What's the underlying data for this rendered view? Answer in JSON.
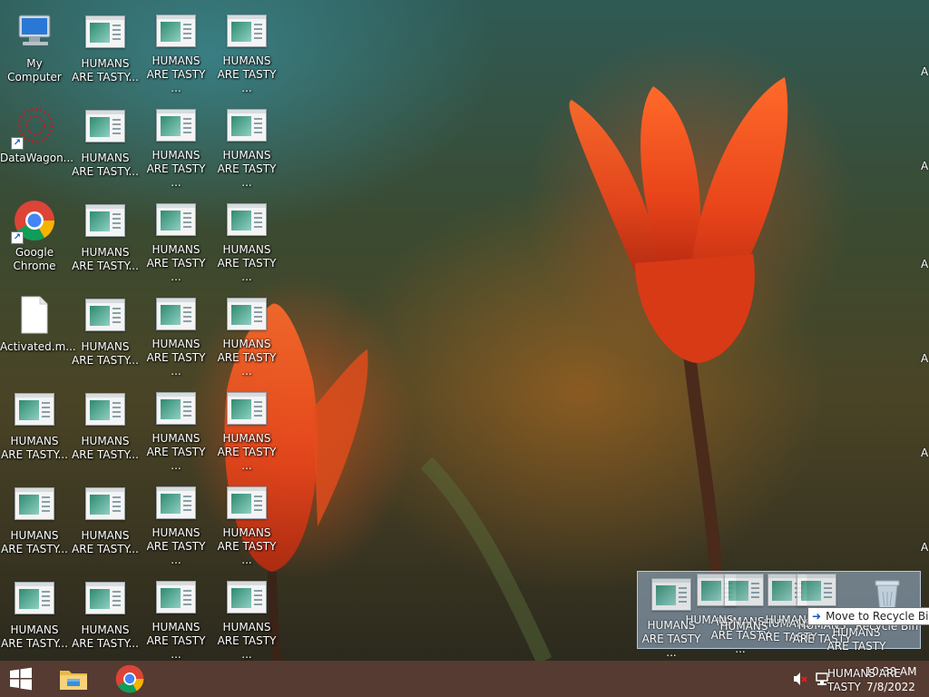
{
  "desktop": {
    "icons": [
      {
        "label": "My Computer",
        "type": "computer"
      },
      {
        "label": "DataWagon...",
        "type": "datawagon"
      },
      {
        "label": "Google Chrome",
        "type": "chrome"
      },
      {
        "label": "Activated.m...",
        "type": "file"
      },
      {
        "label": "HUMANS ARE TASTY...",
        "type": "app"
      },
      {
        "label": "HUMANS ARE TASTY...",
        "type": "app"
      },
      {
        "label": "HUMANS ARE TASTY...",
        "type": "app"
      }
    ],
    "grid_labels": {
      "col2": "HUMANS ARE TASTY...",
      "col3": "HUMANS ARE TASTY ...",
      "col4": "HUMANS ARE TASTY ..."
    },
    "edge_letter": "A"
  },
  "drag": {
    "ghost_labels": [
      "HUMANS ARE TASTY ...",
      "HUMANS ARE TASTY ...",
      "HUMANS ARE TASTY",
      "HUMANS ARE TASTY",
      "HUMANS ARE TASTY"
    ],
    "ghost_partial": [
      "HUMANS",
      "HUMANS",
      "HUMANS",
      "HUMANS ARE TASTY",
      "HUMANS ARE TASTY"
    ],
    "tooltip": "Move to Recycle Bin",
    "recycle_label": "Recycle Bin"
  },
  "taskbar": {
    "start_icon": "windows-logo-icon",
    "pinned": [
      "file-explorer-icon",
      "chrome-icon"
    ],
    "tray": {
      "volume_icon": "volume-muted-icon",
      "network_icon": "network-icon"
    },
    "time": "10:38 AM",
    "date": "7/8/2022"
  },
  "colors": {
    "taskbar": "#46291f",
    "accent": "#1a56c8"
  }
}
